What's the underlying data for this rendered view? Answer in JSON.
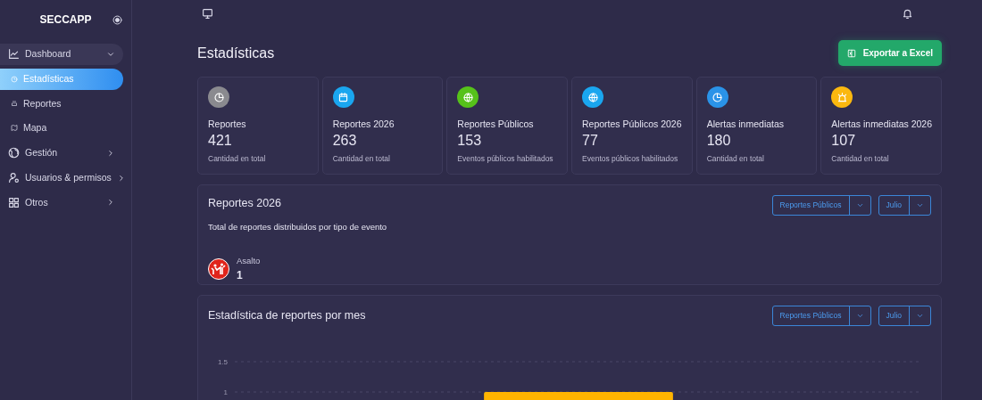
{
  "sidebar": {
    "brand": "SECCAPP",
    "items": [
      {
        "label": "Dashboard",
        "expanded": true,
        "children": [
          {
            "label": "Estadísticas",
            "selected": true
          },
          {
            "label": "Reportes",
            "selected": false
          },
          {
            "label": "Mapa",
            "selected": false
          }
        ]
      },
      {
        "label": "Gestión",
        "expanded": false
      },
      {
        "label": "Usuarios & permisos",
        "expanded": false
      },
      {
        "label": "Otros",
        "expanded": false
      }
    ]
  },
  "page": {
    "title": "Estadísticas",
    "export_button": "Exportar a Excel"
  },
  "stats": [
    {
      "title": "Reportes",
      "value": "421",
      "caption": "Cantidad en total",
      "color": "#8a8a8f"
    },
    {
      "title": "Reportes 2026",
      "value": "263",
      "caption": "Cantidad en total",
      "color": "#1aa6ef"
    },
    {
      "title": "Reportes Públicos",
      "value": "153",
      "caption": "Eventos públicos habilitados",
      "color": "#56c21a"
    },
    {
      "title": "Reportes Públicos 2026",
      "value": "77",
      "caption": "Eventos públicos habilitados",
      "color": "#1aa6ef"
    },
    {
      "title": "Alertas inmediatas",
      "value": "180",
      "caption": "Cantidad en total",
      "color": "#2a93e8"
    },
    {
      "title": "Alertas inmediatas 2026",
      "value": "107",
      "caption": "Cantidad en total",
      "color": "#fbb80f"
    }
  ],
  "distribution": {
    "title": "Reportes 2026",
    "subtitle": "Total de reportes distribuidos por tipo de evento",
    "filters": [
      "Reportes Públicos",
      "Julio"
    ],
    "events": [
      {
        "name": "Asalto",
        "count": "1"
      }
    ]
  },
  "monthly": {
    "title": "Estadística de reportes por mes",
    "filters": [
      "Reportes Públicos",
      "Julio"
    ],
    "chart_data": {
      "type": "bar",
      "values": [
        1
      ],
      "ylim": [
        0,
        1.5
      ],
      "yticks": [
        1,
        1.5
      ]
    }
  }
}
